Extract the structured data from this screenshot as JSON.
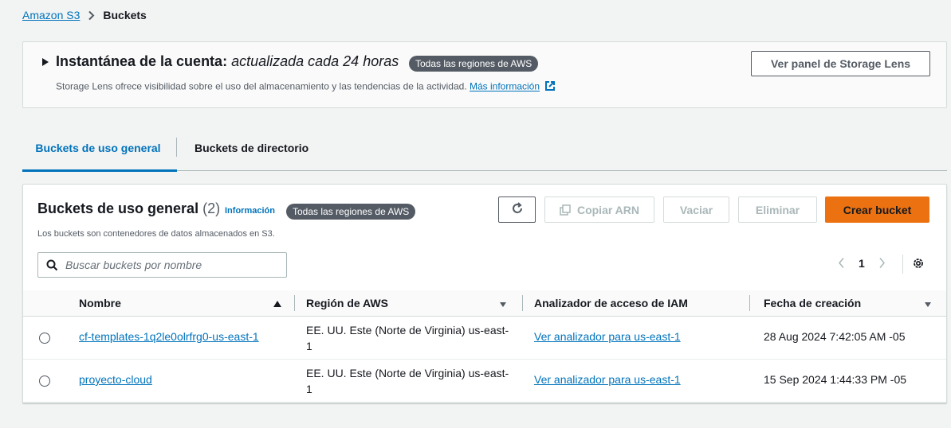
{
  "breadcrumb": {
    "root": "Amazon S3",
    "current": "Buckets"
  },
  "snapshot": {
    "title": "Instantánea de la cuenta:",
    "title_italic": "actualizada cada 24 horas",
    "badge": "Todas las regiones de AWS",
    "description": "Storage Lens ofrece visibilidad sobre el uso del almacenamiento y las tendencias de la actividad.",
    "more_link": "Más información",
    "button": "Ver panel de Storage Lens"
  },
  "tabs": [
    {
      "label": "Buckets de uso general",
      "active": true
    },
    {
      "label": "Buckets de directorio",
      "active": false
    }
  ],
  "panel": {
    "title": "Buckets de uso general",
    "count": "(2)",
    "info": "Información",
    "badge": "Todas las regiones de AWS",
    "description": "Los buckets son contenedores de datos almacenados en S3.",
    "buttons": {
      "copy_arn": "Copiar ARN",
      "empty": "Vaciar",
      "delete": "Eliminar",
      "create": "Crear bucket"
    },
    "search_placeholder": "Buscar buckets por nombre",
    "page": "1"
  },
  "table": {
    "columns": [
      "Nombre",
      "Región de AWS",
      "Analizador de acceso de IAM",
      "Fecha de creación"
    ],
    "rows": [
      {
        "name": "cf-templates-1q2le0olrfrg0-us-east-1",
        "region": "EE. UU. Este (Norte de Virginia) us-east-1",
        "iam": "Ver analizador para us-east-1",
        "date": "28 Aug 2024 7:42:05 AM -05"
      },
      {
        "name": "proyecto-cloud",
        "region": "EE. UU. Este (Norte de Virginia) us-east-1",
        "iam": "Ver analizador para us-east-1",
        "date": "15 Sep 2024 1:44:33 PM -05"
      }
    ]
  },
  "colors": {
    "link": "#0073bb",
    "primary": "#ec7211",
    "badge": "#545b64"
  }
}
